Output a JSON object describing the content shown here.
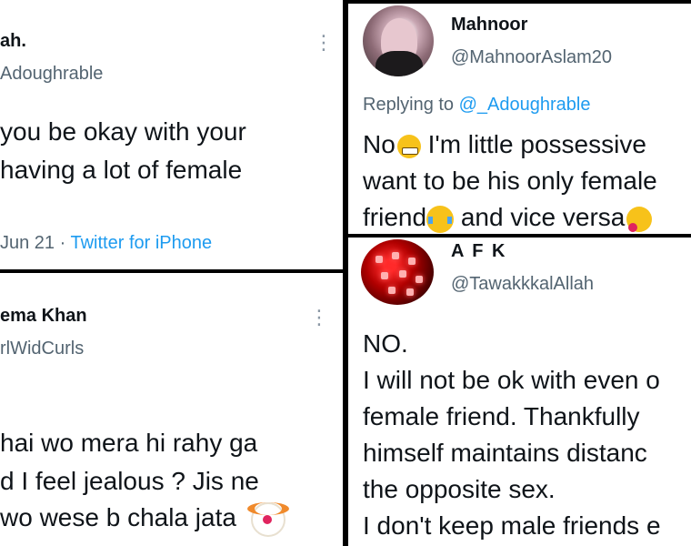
{
  "tweet_top_left": {
    "name": "ah.",
    "handle": "Adoughrable",
    "lines": [
      "you be okay with your",
      "having a lot of female"
    ],
    "date": "Jun 21",
    "separator": "·",
    "source": "Twitter for iPhone",
    "more_glyph": "⋮"
  },
  "tweet_bottom_left": {
    "name": "ema Khan",
    "handle": "rlWidCurls",
    "lines": [
      "hai wo mera hi rahy ga",
      "d I feel jealous ? Jis ne",
      " wo wese b chala jata"
    ],
    "more_glyph": "⋮"
  },
  "tweet_top_right": {
    "name": "Mahnoor",
    "handle": "@MahnoorAslam20",
    "replying_prefix": "Replying to",
    "replying_handle": "@_Adoughrable",
    "line1_a": "No",
    "line1_b": " I'm little possessive",
    "line2": "want to be his only female",
    "line3_a": "friend",
    "line3_b": " and vice versa"
  },
  "tweet_bottom_right": {
    "name": "A F K",
    "handle": "@TawakkkalAllah",
    "lines": [
      "NO.",
      "I will not be ok with even o",
      "female friend. Thankfully",
      "himself maintains distanc",
      "the opposite sex.",
      "I don't keep male friends e"
    ]
  },
  "emoji": {
    "grimace": "grimacing-face-emoji",
    "joy": "face-with-tears-of-joy-emoji",
    "love": "smiling-face-with-hearts-emoji",
    "clown": "clown-face-emoji"
  },
  "colors": {
    "link": "#1d9bf0",
    "muted": "#536471",
    "text": "#0f1419",
    "divider": "#000000"
  }
}
